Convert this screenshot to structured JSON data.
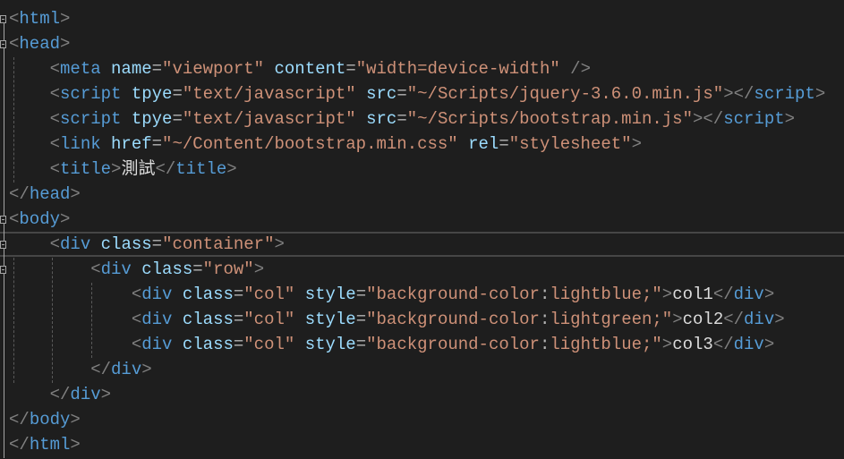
{
  "editor": {
    "lines": [
      {
        "indent": "",
        "tokens": [
          [
            "delim",
            "<"
          ],
          [
            "tag",
            "html"
          ],
          [
            "delim",
            ">"
          ]
        ]
      },
      {
        "indent": "",
        "tokens": [
          [
            "delim",
            "<"
          ],
          [
            "tag",
            "head"
          ],
          [
            "delim",
            ">"
          ]
        ]
      },
      {
        "indent": "    ",
        "tokens": [
          [
            "delim",
            "<"
          ],
          [
            "tag",
            "meta"
          ],
          [
            "text",
            " "
          ],
          [
            "attr",
            "name"
          ],
          [
            "op",
            "="
          ],
          [
            "val",
            "\"viewport\""
          ],
          [
            "text",
            " "
          ],
          [
            "attr",
            "content"
          ],
          [
            "op",
            "="
          ],
          [
            "val",
            "\"width=device-width\""
          ],
          [
            "text",
            " "
          ],
          [
            "delim",
            "/>"
          ]
        ]
      },
      {
        "indent": "    ",
        "tokens": [
          [
            "delim",
            "<"
          ],
          [
            "tag",
            "script"
          ],
          [
            "text",
            " "
          ],
          [
            "attr",
            "tpye"
          ],
          [
            "op",
            "="
          ],
          [
            "val",
            "\"text/javascript\""
          ],
          [
            "text",
            " "
          ],
          [
            "attr",
            "src"
          ],
          [
            "op",
            "="
          ],
          [
            "val",
            "\"~/Scripts/jquery-3.6.0.min.js\""
          ],
          [
            "delim",
            "></"
          ],
          [
            "tag",
            "script"
          ],
          [
            "delim",
            ">"
          ]
        ]
      },
      {
        "indent": "    ",
        "tokens": [
          [
            "delim",
            "<"
          ],
          [
            "tag",
            "script"
          ],
          [
            "text",
            " "
          ],
          [
            "attr",
            "tpye"
          ],
          [
            "op",
            "="
          ],
          [
            "val",
            "\"text/javascript\""
          ],
          [
            "text",
            " "
          ],
          [
            "attr",
            "src"
          ],
          [
            "op",
            "="
          ],
          [
            "val",
            "\"~/Scripts/bootstrap.min.js\""
          ],
          [
            "delim",
            "></"
          ],
          [
            "tag",
            "script"
          ],
          [
            "delim",
            ">"
          ]
        ]
      },
      {
        "indent": "    ",
        "tokens": [
          [
            "delim",
            "<"
          ],
          [
            "tag",
            "link"
          ],
          [
            "text",
            " "
          ],
          [
            "attr",
            "href"
          ],
          [
            "op",
            "="
          ],
          [
            "val",
            "\"~/Content/bootstrap.min.css\""
          ],
          [
            "text",
            " "
          ],
          [
            "attr",
            "rel"
          ],
          [
            "op",
            "="
          ],
          [
            "val",
            "\"stylesheet\""
          ],
          [
            "delim",
            ">"
          ]
        ]
      },
      {
        "indent": "    ",
        "tokens": [
          [
            "delim",
            "<"
          ],
          [
            "tag",
            "title"
          ],
          [
            "delim",
            ">"
          ],
          [
            "text",
            "測試"
          ],
          [
            "delim",
            "</"
          ],
          [
            "tag",
            "title"
          ],
          [
            "delim",
            ">"
          ]
        ]
      },
      {
        "indent": "",
        "tokens": [
          [
            "delim",
            "</"
          ],
          [
            "tag",
            "head"
          ],
          [
            "delim",
            ">"
          ]
        ]
      },
      {
        "indent": "",
        "tokens": [
          [
            "delim",
            "<"
          ],
          [
            "tag",
            "body"
          ],
          [
            "delim",
            ">"
          ]
        ]
      },
      {
        "indent": "    ",
        "tokens": [
          [
            "delim",
            "<"
          ],
          [
            "tag",
            "div"
          ],
          [
            "text",
            " "
          ],
          [
            "attr",
            "class"
          ],
          [
            "op",
            "="
          ],
          [
            "val",
            "\"container\""
          ],
          [
            "delim",
            ">"
          ]
        ]
      },
      {
        "indent": "        ",
        "tokens": [
          [
            "delim",
            "<"
          ],
          [
            "tag",
            "div"
          ],
          [
            "text",
            " "
          ],
          [
            "attr",
            "class"
          ],
          [
            "op",
            "="
          ],
          [
            "val",
            "\"row\""
          ],
          [
            "delim",
            ">"
          ]
        ]
      },
      {
        "indent": "            ",
        "tokens": [
          [
            "delim",
            "<"
          ],
          [
            "tag",
            "div"
          ],
          [
            "text",
            " "
          ],
          [
            "attr",
            "class"
          ],
          [
            "op",
            "="
          ],
          [
            "val",
            "\"col\""
          ],
          [
            "text",
            " "
          ],
          [
            "attr",
            "style"
          ],
          [
            "op",
            "="
          ],
          [
            "val",
            "\"background-color"
          ],
          [
            "op",
            ":"
          ],
          [
            "val",
            "lightblue;\""
          ],
          [
            "delim",
            ">"
          ],
          [
            "text",
            "col1"
          ],
          [
            "delim",
            "</"
          ],
          [
            "tag",
            "div"
          ],
          [
            "delim",
            ">"
          ]
        ]
      },
      {
        "indent": "            ",
        "tokens": [
          [
            "delim",
            "<"
          ],
          [
            "tag",
            "div"
          ],
          [
            "text",
            " "
          ],
          [
            "attr",
            "class"
          ],
          [
            "op",
            "="
          ],
          [
            "val",
            "\"col\""
          ],
          [
            "text",
            " "
          ],
          [
            "attr",
            "style"
          ],
          [
            "op",
            "="
          ],
          [
            "val",
            "\"background-color"
          ],
          [
            "op",
            ":"
          ],
          [
            "val",
            "lightgreen;\""
          ],
          [
            "delim",
            ">"
          ],
          [
            "text",
            "col2"
          ],
          [
            "delim",
            "</"
          ],
          [
            "tag",
            "div"
          ],
          [
            "delim",
            ">"
          ]
        ]
      },
      {
        "indent": "            ",
        "tokens": [
          [
            "delim",
            "<"
          ],
          [
            "tag",
            "div"
          ],
          [
            "text",
            " "
          ],
          [
            "attr",
            "class"
          ],
          [
            "op",
            "="
          ],
          [
            "val",
            "\"col\""
          ],
          [
            "text",
            " "
          ],
          [
            "attr",
            "style"
          ],
          [
            "op",
            "="
          ],
          [
            "val",
            "\"background-color"
          ],
          [
            "op",
            ":"
          ],
          [
            "val",
            "lightblue;\""
          ],
          [
            "delim",
            ">"
          ],
          [
            "text",
            "col3"
          ],
          [
            "delim",
            "</"
          ],
          [
            "tag",
            "div"
          ],
          [
            "delim",
            ">"
          ]
        ]
      },
      {
        "indent": "        ",
        "tokens": [
          [
            "delim",
            "</"
          ],
          [
            "tag",
            "div"
          ],
          [
            "delim",
            ">"
          ]
        ]
      },
      {
        "indent": "    ",
        "tokens": [
          [
            "delim",
            "</"
          ],
          [
            "tag",
            "div"
          ],
          [
            "delim",
            ">"
          ]
        ]
      },
      {
        "indent": "",
        "tokens": [
          [
            "delim",
            "</"
          ],
          [
            "tag",
            "body"
          ],
          [
            "delim",
            ">"
          ]
        ]
      },
      {
        "indent": "",
        "tokens": [
          [
            "delim",
            "</"
          ],
          [
            "tag",
            "html"
          ],
          [
            "delim",
            ">"
          ]
        ]
      }
    ],
    "current_line": 10
  },
  "colors": {
    "background": "#1e1e1e",
    "delimiter": "#808080",
    "tag": "#569cd6",
    "attribute": "#9cdcfe",
    "value": "#ce9178",
    "text": "#dcdcdc"
  },
  "icons": {
    "fold_toggle": "collapse-box-icon"
  }
}
